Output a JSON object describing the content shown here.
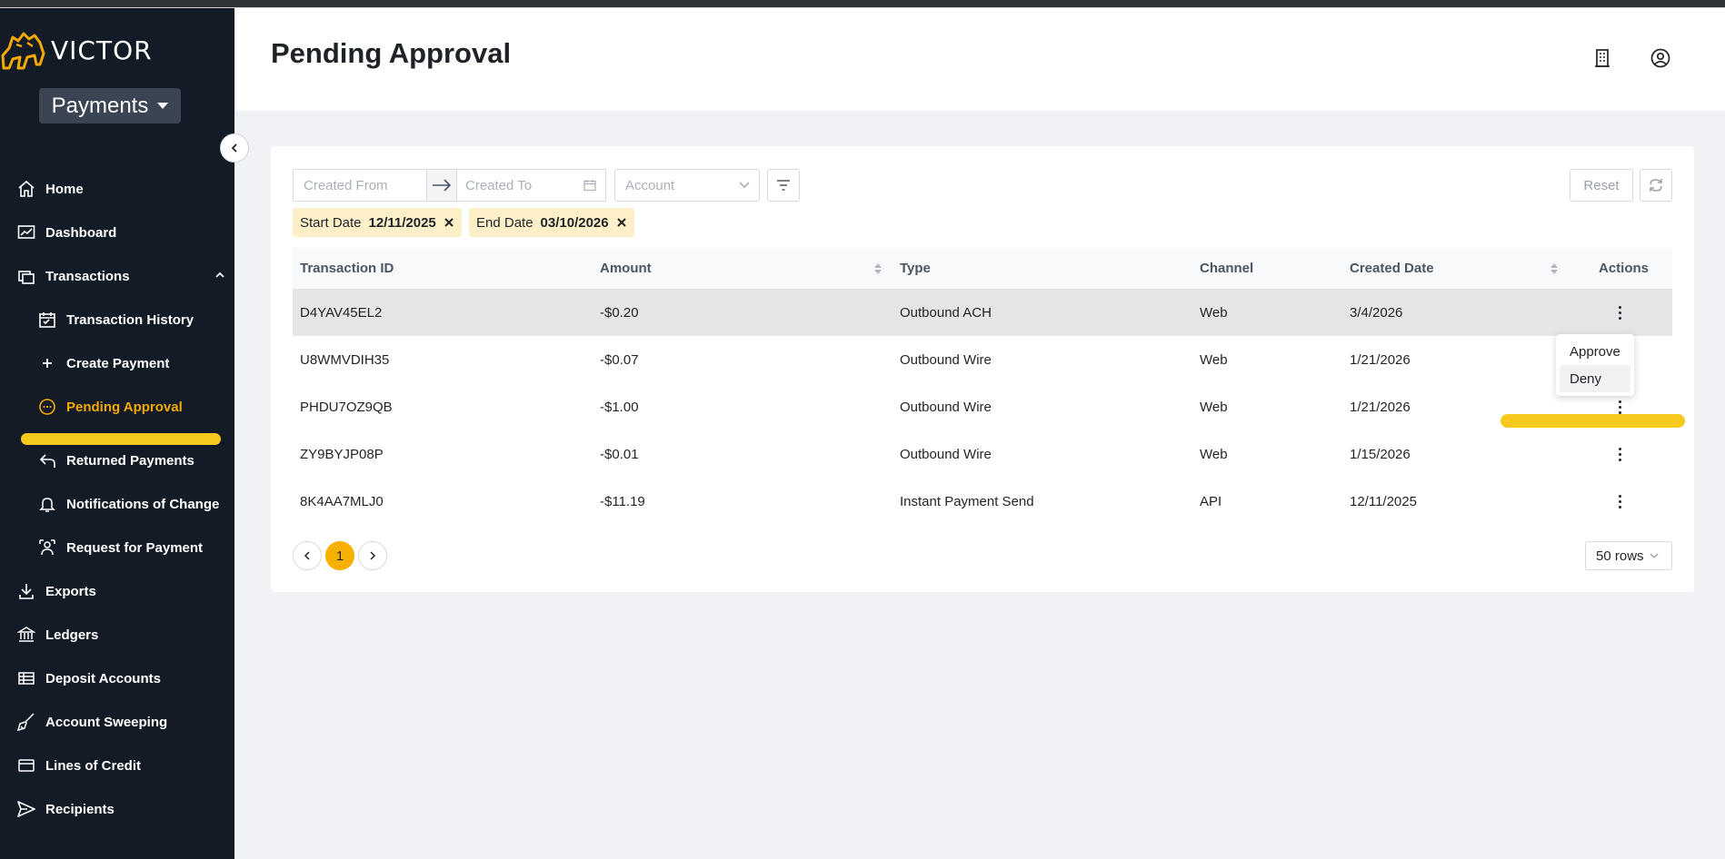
{
  "brand": {
    "name": "VICTOR",
    "accent": "#f5a800",
    "sidebar_bg": "#131b26"
  },
  "app_switcher": {
    "label": "Payments"
  },
  "sidebar": {
    "items": [
      {
        "label": "Home",
        "icon": "home-icon"
      },
      {
        "label": "Dashboard",
        "icon": "dashboard-icon"
      },
      {
        "label": "Transactions",
        "icon": "transactions-icon",
        "expanded": true
      },
      {
        "label": "Transaction History",
        "icon": "calendar-icon"
      },
      {
        "label": "Create Payment",
        "icon": "plus-icon"
      },
      {
        "label": "Pending Approval",
        "icon": "pending-icon",
        "active": true
      },
      {
        "label": "Returned Payments",
        "icon": "return-icon"
      },
      {
        "label": "Notifications of Change",
        "icon": "bell-icon"
      },
      {
        "label": "Request for Payment",
        "icon": "request-icon"
      },
      {
        "label": "Exports",
        "icon": "download-icon"
      },
      {
        "label": "Ledgers",
        "icon": "bank-icon"
      },
      {
        "label": "Deposit Accounts",
        "icon": "table-icon"
      },
      {
        "label": "Account Sweeping",
        "icon": "broom-icon"
      },
      {
        "label": "Lines of Credit",
        "icon": "credit-card-icon"
      },
      {
        "label": "Recipients",
        "icon": "send-icon"
      }
    ]
  },
  "header": {
    "title": "Pending Approval"
  },
  "filters": {
    "created_from_placeholder": "Created From",
    "created_to_placeholder": "Created To",
    "account_placeholder": "Account",
    "reset_label": "Reset",
    "chips": [
      {
        "label": "Start Date",
        "value": "12/11/2025"
      },
      {
        "label": "End Date",
        "value": "03/10/2026"
      }
    ]
  },
  "table": {
    "columns": [
      "Transaction ID",
      "Amount",
      "Type",
      "Channel",
      "Created Date",
      "Actions"
    ],
    "rows": [
      {
        "id": "D4YAV45EL2",
        "amount": "-$0.20",
        "type": "Outbound ACH",
        "channel": "Web",
        "date": "3/4/2026"
      },
      {
        "id": "U8WMVDIH35",
        "amount": "-$0.07",
        "type": "Outbound Wire",
        "channel": "Web",
        "date": "1/21/2026"
      },
      {
        "id": "PHDU7OZ9QB",
        "amount": "-$1.00",
        "type": "Outbound Wire",
        "channel": "Web",
        "date": "1/21/2026"
      },
      {
        "id": "ZY9BYJP08P",
        "amount": "-$0.01",
        "type": "Outbound Wire",
        "channel": "Web",
        "date": "1/15/2026"
      },
      {
        "id": "8K4AA7MLJ0",
        "amount": "-$11.19",
        "type": "Instant Payment Send",
        "channel": "API",
        "date": "12/11/2025"
      }
    ]
  },
  "action_menu": {
    "items": [
      "Approve",
      "Deny"
    ]
  },
  "pagination": {
    "current_page": "1",
    "rows_per_page": "50 rows"
  }
}
